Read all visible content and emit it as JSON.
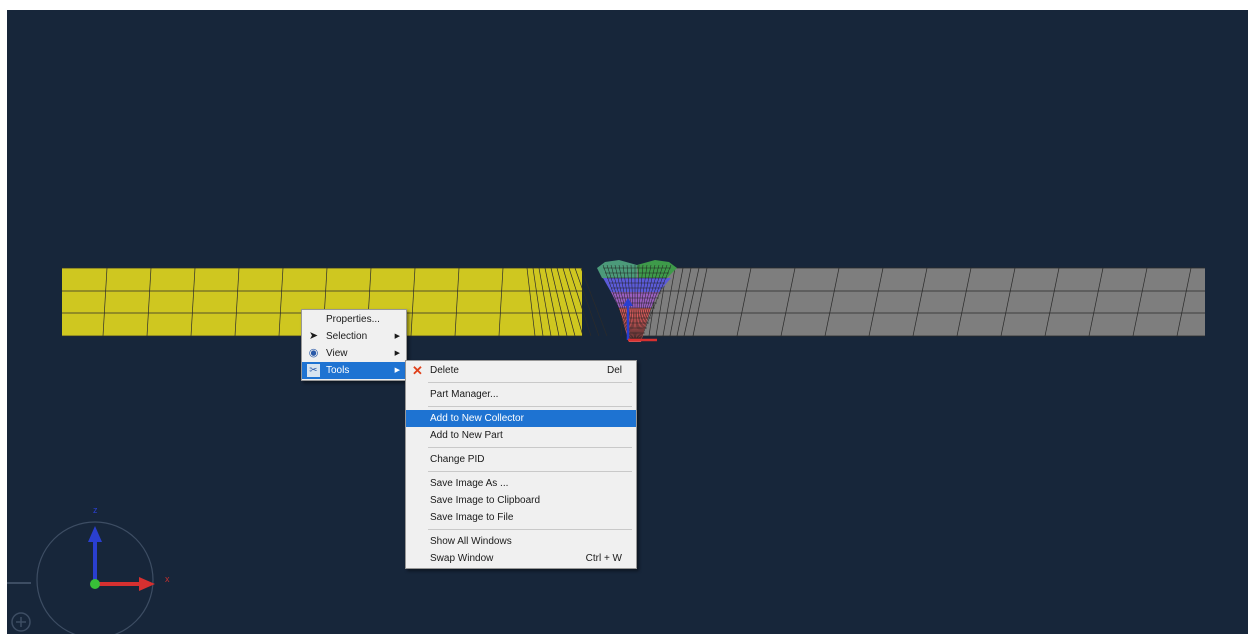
{
  "colors": {
    "background": "#17263a",
    "mesh_left": "#cfc720",
    "mesh_right": "#7e7e7e",
    "menu_bg": "#f0f0f0",
    "menu_highlight": "#1e73d2",
    "axis_x": "#d63030",
    "axis_y": "#2a3fd0",
    "axis_origin": "#38c038"
  },
  "triad": {
    "x_label": "x",
    "z_label": "z"
  },
  "context_menu": {
    "items": [
      {
        "label": "Properties...",
        "icon": ""
      },
      {
        "label": "Selection",
        "icon": "pointer-icon",
        "submenu": true
      },
      {
        "label": "View",
        "icon": "eye-icon",
        "submenu": true
      },
      {
        "label": "Tools",
        "icon": "tools-icon",
        "submenu": true,
        "active": true
      }
    ]
  },
  "tools_submenu": {
    "groups": [
      [
        {
          "label": "Delete",
          "shortcut": "Del",
          "icon": "delete-icon"
        }
      ],
      [
        {
          "label": "Part Manager..."
        }
      ],
      [
        {
          "label": "Add to New Collector",
          "highlighted": true
        },
        {
          "label": "Add to New Part"
        }
      ],
      [
        {
          "label": "Change PID"
        }
      ],
      [
        {
          "label": "Save Image As ..."
        },
        {
          "label": "Save Image to Clipboard"
        },
        {
          "label": "Save Image to File"
        }
      ],
      [
        {
          "label": "Show All Windows"
        },
        {
          "label": "Swap Window",
          "shortcut": "Ctrl + W"
        }
      ]
    ]
  }
}
